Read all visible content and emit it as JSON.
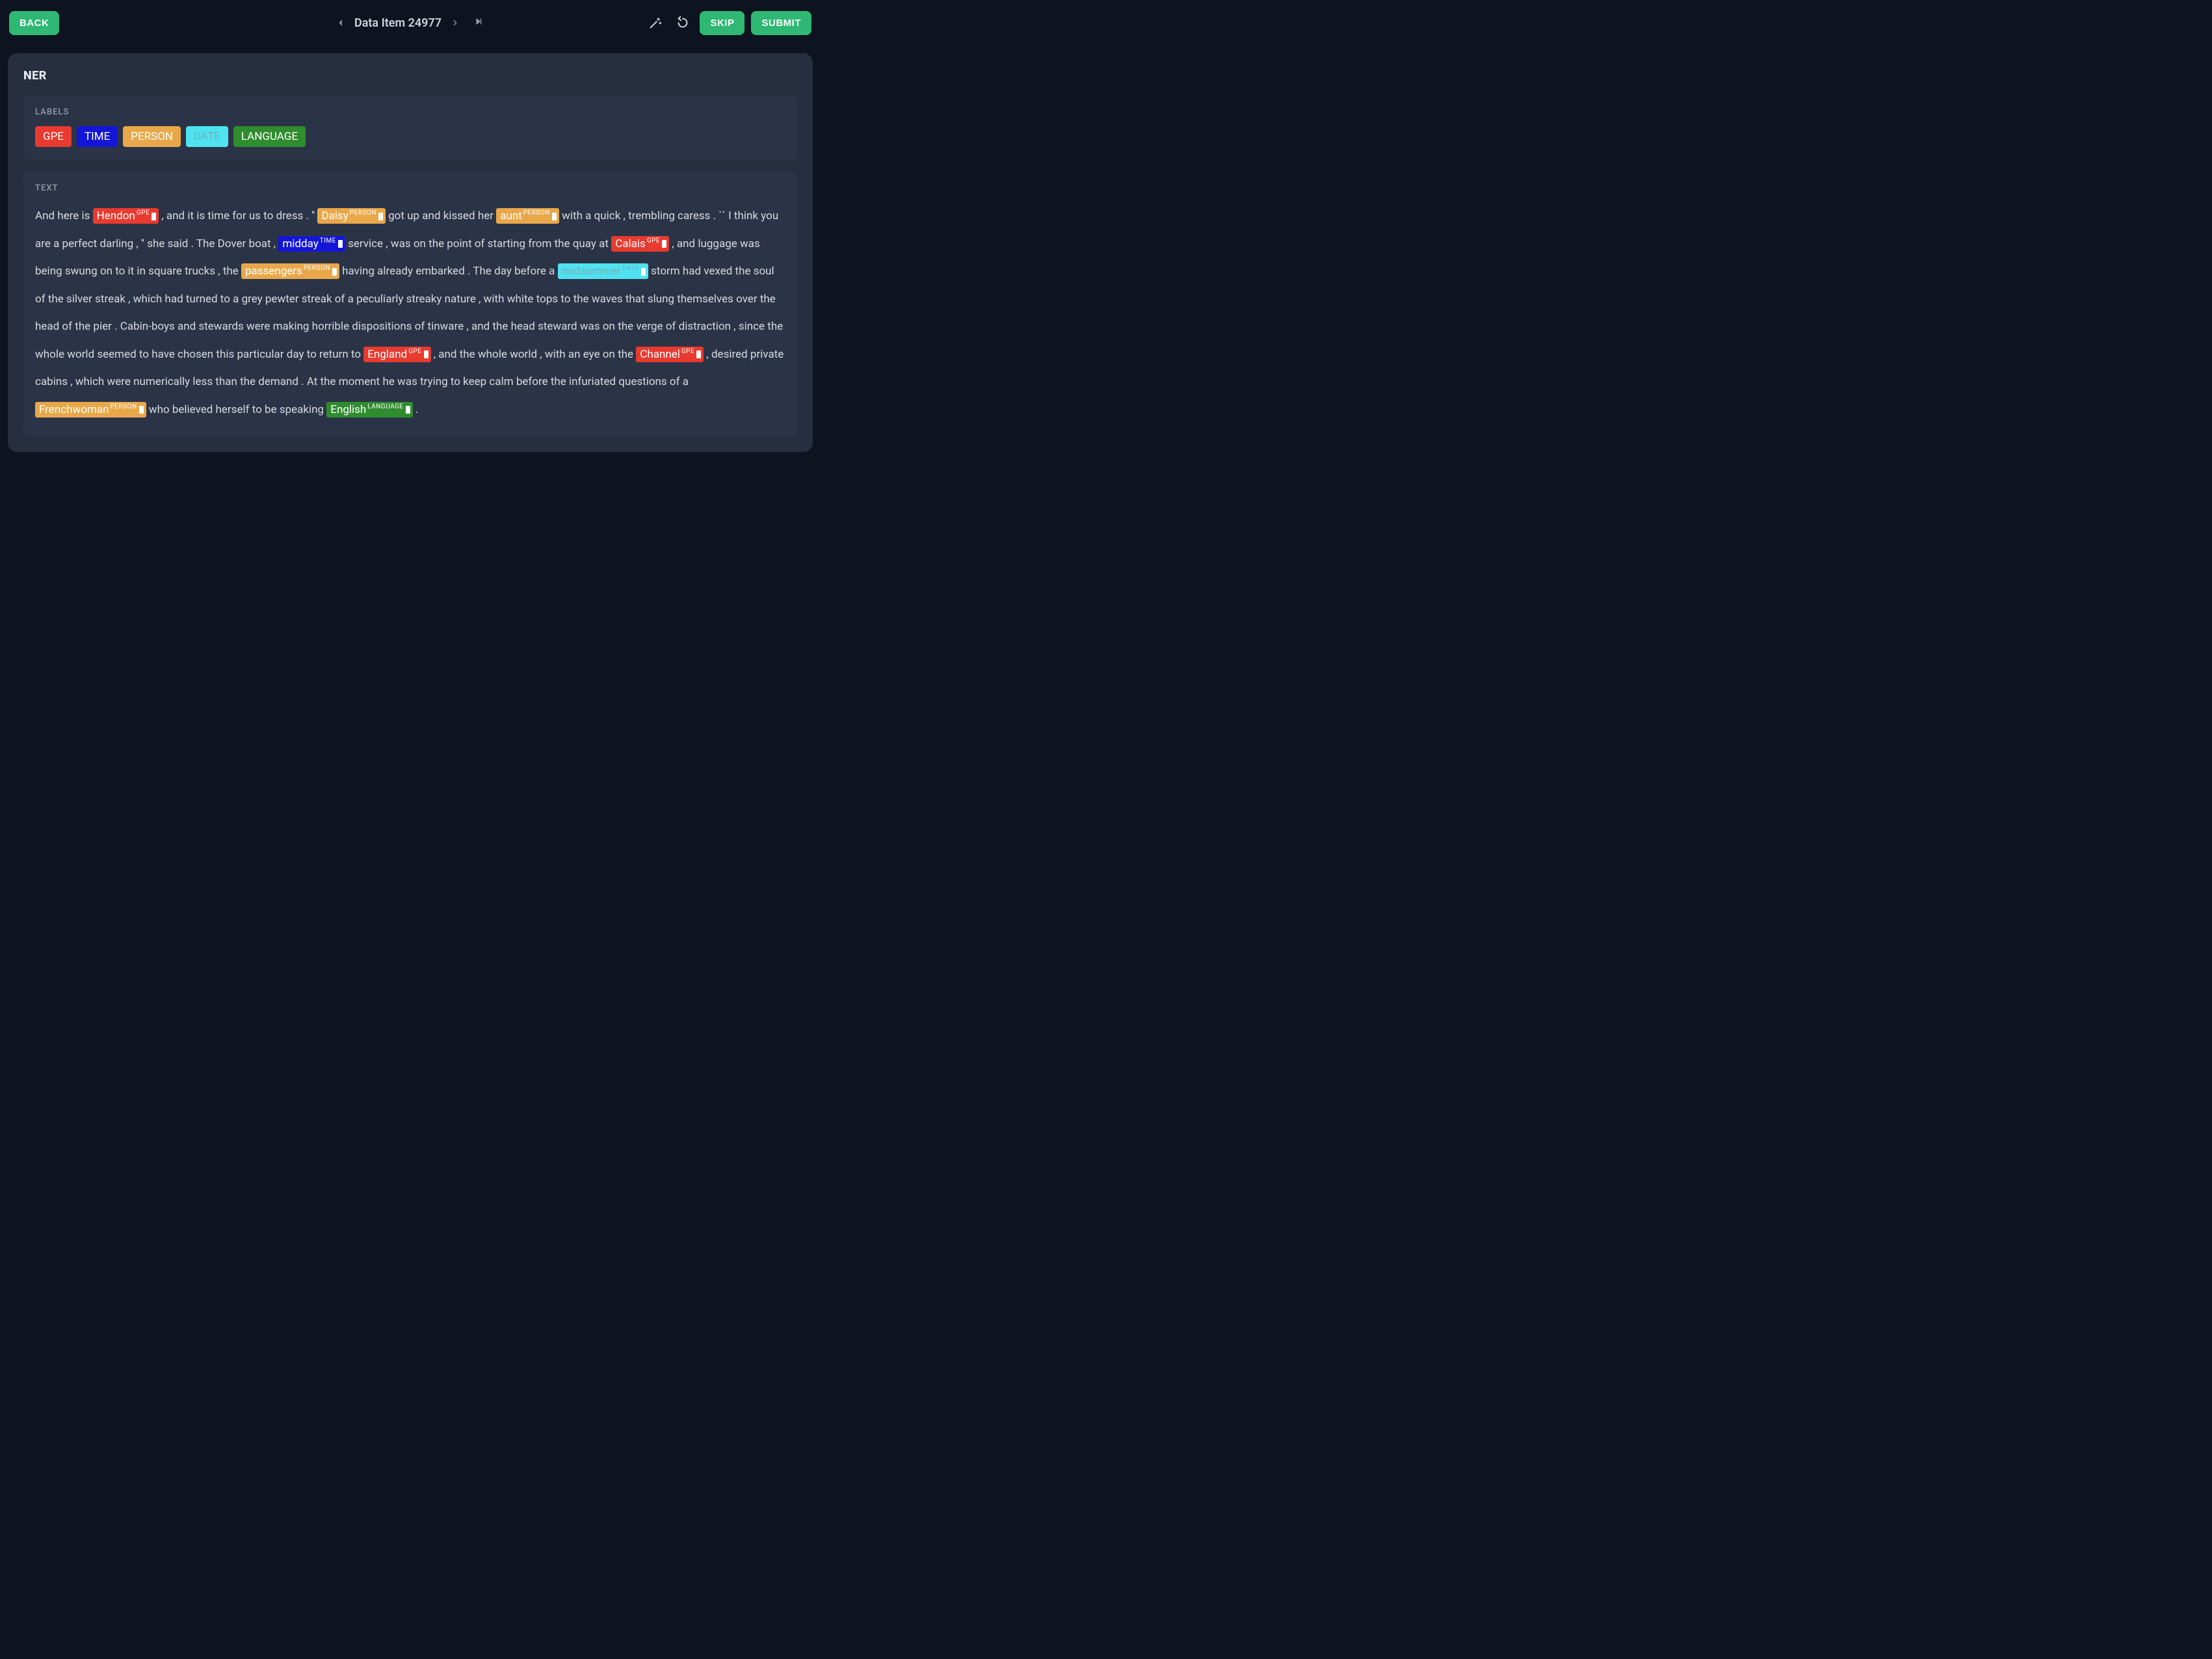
{
  "header": {
    "back_label": "BACK",
    "title": "Data Item 24977",
    "skip_label": "SKIP",
    "submit_label": "SUBMIT"
  },
  "panel": {
    "title": "NER",
    "labels_heading": "LABELS",
    "text_heading": "TEXT"
  },
  "labels": [
    {
      "name": "GPE",
      "color": "#e83a2f"
    },
    {
      "name": "TIME",
      "color": "#1316d6"
    },
    {
      "name": "PERSON",
      "color": "#e8a84a"
    },
    {
      "name": "DATE",
      "color": "#4fe3f2",
      "text_color": "#6fb0b8"
    },
    {
      "name": "LANGUAGE",
      "color": "#2f8c2f"
    }
  ],
  "text_tokens": [
    {
      "t": "And here is "
    },
    {
      "t": "Hendon",
      "label": "GPE"
    },
    {
      "t": " , and it is time for us to dress . '' "
    },
    {
      "t": "Daisy",
      "label": "PERSON"
    },
    {
      "t": " got up and kissed her "
    },
    {
      "t": "aunt",
      "label": "PERSON"
    },
    {
      "t": " with a quick , trembling caress . `` I think you are a perfect darling , '' she said . The Dover boat , "
    },
    {
      "t": "midday",
      "label": "TIME"
    },
    {
      "t": " service , was on the point of starting from the quay at "
    },
    {
      "t": "Calais",
      "label": "GPE"
    },
    {
      "t": " , and luggage was being swung on to it in square trucks , the "
    },
    {
      "t": "passengers",
      "label": "PERSON"
    },
    {
      "t": " having already embarked . The day before a "
    },
    {
      "t": "midsummer",
      "label": "DATE"
    },
    {
      "t": " storm had vexed the soul of the silver streak , which had turned to a grey pewter streak of a peculiarly streaky nature , with white tops to the waves that slung themselves over the head of the pier . Cabin-boys and stewards were making horrible dispositions of tinware , and the head steward was on the verge of distraction , since the whole world seemed to have chosen this particular day to return to "
    },
    {
      "t": "England",
      "label": "GPE"
    },
    {
      "t": " , and the whole world , with an eye on the "
    },
    {
      "t": "Channel",
      "label": "GPE"
    },
    {
      "t": " , desired private cabins , which were numerically less than the demand . At the moment he was trying to keep calm before the infuriated questions of a "
    },
    {
      "t": "Frenchwoman",
      "label": "PERSON"
    },
    {
      "t": " who believed herself to be speaking "
    },
    {
      "t": "English",
      "label": "LANGUAGE"
    },
    {
      "t": " ."
    }
  ]
}
